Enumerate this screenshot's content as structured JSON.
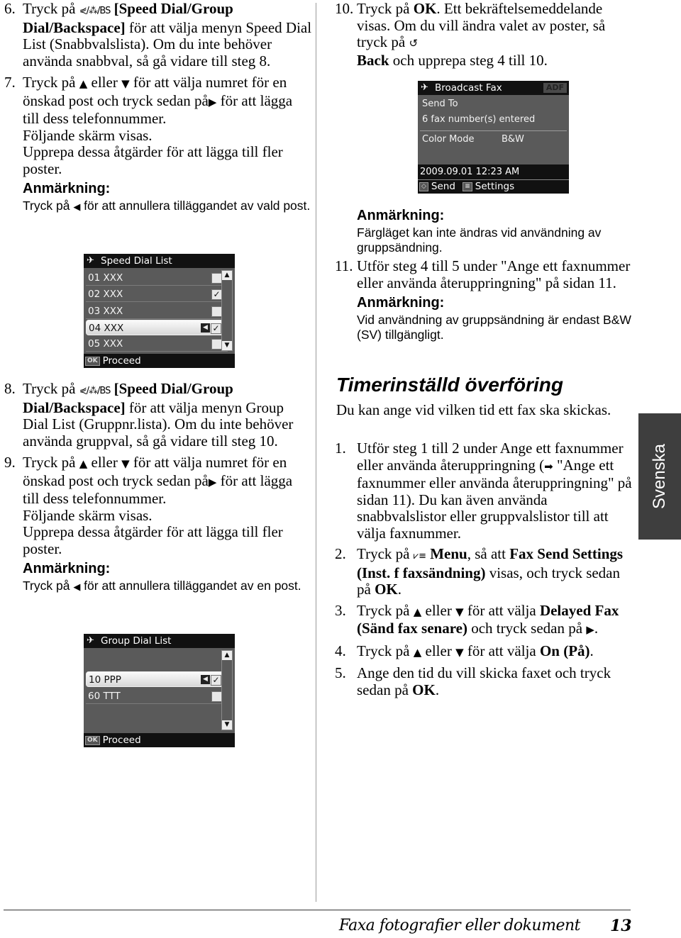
{
  "left_column": {
    "step6": {
      "num": "6.",
      "pre": "Tryck på ",
      "icon_label": "⋞/⁂/BS",
      "bold": " [Speed Dial/Group Dial/Backspace]",
      "post": " för att välja menyn Speed Dial List (Snabbvalslista). Om du inte behöver använda snabbval, så gå vidare till steg 8."
    },
    "step7": {
      "num": "7.",
      "text_a": "Tryck på ",
      "up": "▲",
      "text_b": " eller ",
      "down": "▼",
      "text_c": " för att välja numret för en önskad post och tryck sedan på",
      "right": "▶",
      "text_d": " för att lägga till dess telefonnummer.",
      "line2": "Följande skärm visas.",
      "line3": "Upprepa dessa åtgärder för att lägga till fler poster."
    },
    "note1": {
      "title": "Anmärkning:",
      "pre": "Tryck på ",
      "left": "◀",
      "post": " för att annullera tilläggandet av vald post."
    },
    "speed_dial_screen": {
      "title": "Speed Dial List",
      "rows": [
        {
          "label": "01 XXX",
          "checked": false,
          "selected": false
        },
        {
          "label": "02 XXX",
          "checked": true,
          "selected": false
        },
        {
          "label": "03 XXX",
          "checked": false,
          "selected": false
        },
        {
          "label": "04 XXX",
          "checked": true,
          "selected": true
        },
        {
          "label": "05 XXX",
          "checked": false,
          "selected": false
        }
      ],
      "ok_key": "OK",
      "footer": "Proceed"
    },
    "step8": {
      "num": "8.",
      "pre": "Tryck på ",
      "icon_label": "⋞/⁂/BS",
      "bold": " [Speed Dial/Group Dial/Backspace]",
      "post": " för att välja menyn Group Dial List (Gruppnr.lista). Om du inte behöver använda gruppval, så gå vidare till steg 10."
    },
    "step9": {
      "num": "9.",
      "text_a": "Tryck på ",
      "up": "▲",
      "text_b": " eller ",
      "down": "▼",
      "text_c": " för att välja numret för en önskad post och tryck sedan på",
      "right": "▶",
      "text_d": " för att lägga till dess telefonnummer.",
      "line2": "Följande skärm visas.",
      "line3": "Upprepa dessa åtgärder för att lägga till fler poster."
    },
    "note2": {
      "title": "Anmärkning:",
      "pre": "Tryck på ",
      "left": "◀",
      "post": " för att annullera tilläggandet av en post."
    },
    "group_dial_screen": {
      "title": "Group Dial List",
      "rows": [
        {
          "label": "10 PPP",
          "checked": true,
          "selected": true
        },
        {
          "label": "60 TTT",
          "checked": false,
          "selected": false
        }
      ],
      "ok_key": "OK",
      "footer": "Proceed"
    }
  },
  "right_column": {
    "step10": {
      "num": "10.",
      "pre": "Tryck på ",
      "ok": "OK",
      "mid": ". Ett bekräftelsemeddelande visas. Om du vill ändra valet av poster, så tryck på ",
      "back_icon": "↺",
      "back": "Back",
      "post": " och upprepa steg 4 till 10."
    },
    "broadcast_screen": {
      "title": "Broadcast Fax",
      "badge": "ADF",
      "send_to_label": "Send To",
      "send_to_value": "6 fax number(s) entered",
      "color_mode_label": "Color Mode",
      "color_mode_value": "B&W",
      "datetime": "2009.09.01  12:23 AM",
      "send_label": "Send",
      "settings_label": "Settings"
    },
    "note3": {
      "title": "Anmärkning:",
      "body": "Färgläget kan inte ändras vid användning av gruppsändning."
    },
    "step11": {
      "num": "11.",
      "text": "Utför steg 4 till 5 under \"Ange ett faxnummer eller använda återuppringning\" på sidan 11."
    },
    "note4": {
      "title": "Anmärkning:",
      "body": "Vid användning av gruppsändning är endast B&W (SV) tillgängligt."
    },
    "section_heading": "Timerinställd överföring",
    "intro": "Du kan ange vid vilken tid ett fax ska skickas.",
    "steps": {
      "s1": {
        "num": "1.",
        "pre": "Utför steg 1 till 2 under Ange ett faxnummer eller använda återuppringning (",
        "arrow": "➡",
        "post": " \"Ange ett faxnummer eller använda återuppringning\" på sidan 11). Du kan även använda snabbvalslistor eller gruppvalslistor till att välja faxnummer."
      },
      "s2": {
        "num": "2.",
        "pre": "Tryck på ",
        "menu_icon": "⩗≡",
        "menu": "Menu",
        "mid": ", så att ",
        "bold": "Fax Send Settings (Inst. f faxsändning)",
        "mid2": " visas, och tryck sedan på ",
        "ok": "OK",
        "post": "."
      },
      "s3": {
        "num": "3.",
        "pre": "Tryck på ",
        "up": "▲",
        "or": " eller ",
        "down": "▼",
        "mid": " för att välja ",
        "bold": "Delayed Fax (Sänd fax senare)",
        "mid2": " och tryck sedan på ",
        "right": "▶",
        "post": "."
      },
      "s4": {
        "num": "4.",
        "pre": "Tryck på ",
        "up": "▲",
        "or": " eller ",
        "down": "▼",
        "mid": " för att välja ",
        "bold": "On (På)",
        "post": "."
      },
      "s5": {
        "num": "5.",
        "pre": "Ange den tid du vill skicka faxet och tryck sedan på ",
        "ok": "OK",
        "post": "."
      }
    }
  },
  "side_tab": "Svenska",
  "footer": {
    "title": "Faxa fotografier eller dokument",
    "page_number": "13"
  }
}
